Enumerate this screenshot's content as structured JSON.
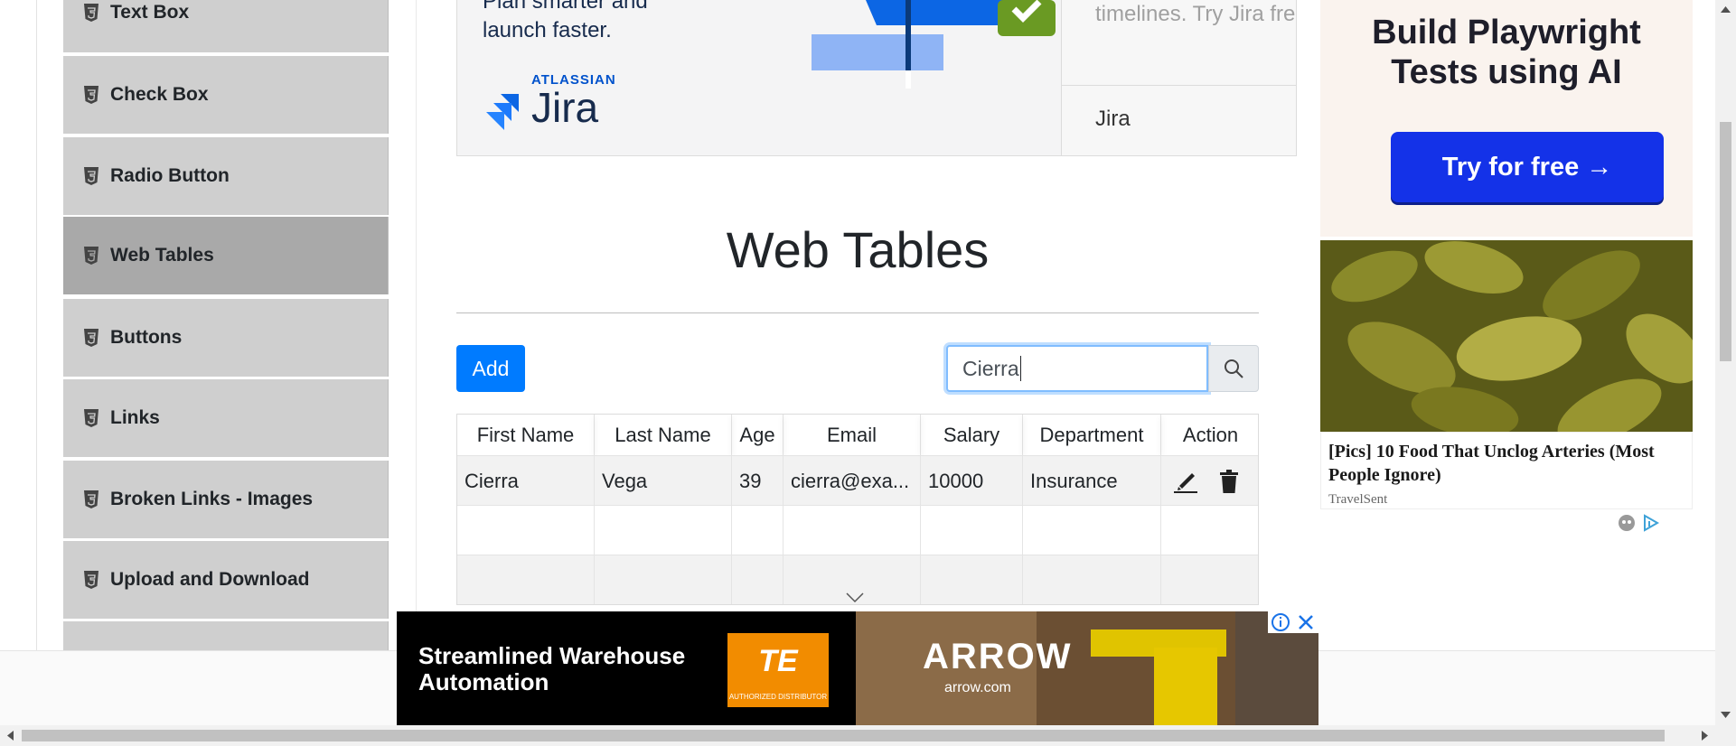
{
  "menu": {
    "items": [
      {
        "label": "Text Box"
      },
      {
        "label": "Check Box"
      },
      {
        "label": "Radio Button"
      },
      {
        "label": "Web Tables",
        "active": true
      },
      {
        "label": "Buttons"
      },
      {
        "label": "Links"
      },
      {
        "label": "Broken Links - Images"
      },
      {
        "label": "Upload and Download"
      }
    ]
  },
  "jira_ad": {
    "tagline_line1": "Plan smarter and",
    "tagline_line2": "launch faster.",
    "brand_small": "ATLASSIAN",
    "brand": "Jira",
    "right_text": "timelines. Try Jira fre",
    "right_brand": "Jira"
  },
  "page": {
    "title": "Web Tables"
  },
  "toolbar": {
    "add_label": "Add",
    "search_value": "Cierra"
  },
  "table": {
    "headers": [
      "First Name",
      "Last Name",
      "Age",
      "Email",
      "Salary",
      "Department",
      "Action"
    ],
    "rows": [
      {
        "first": "Cierra",
        "last": "Vega",
        "age": "39",
        "email": "cierra@exa...",
        "salary": "10000",
        "department": "Insurance"
      }
    ]
  },
  "right_ad": {
    "title_line1": "Build Playwright",
    "title_line2": "Tests using AI",
    "button": "Try for free →",
    "caption": "[Pics] 10 Food That Unclog Arteries (Most People Ignore)",
    "source": "TravelSent"
  },
  "bottom_ad": {
    "line1": "Streamlined Warehouse",
    "line2": "Automation",
    "logo": "TE",
    "logo_sub": "AUTHORIZED DISTRIBUTOR",
    "brand": "ARROW",
    "url": "arrow.com"
  },
  "colors": {
    "accent": "#007bff",
    "menu_bg": "#cfcfcf",
    "menu_active_bg": "#a9a9a9"
  }
}
